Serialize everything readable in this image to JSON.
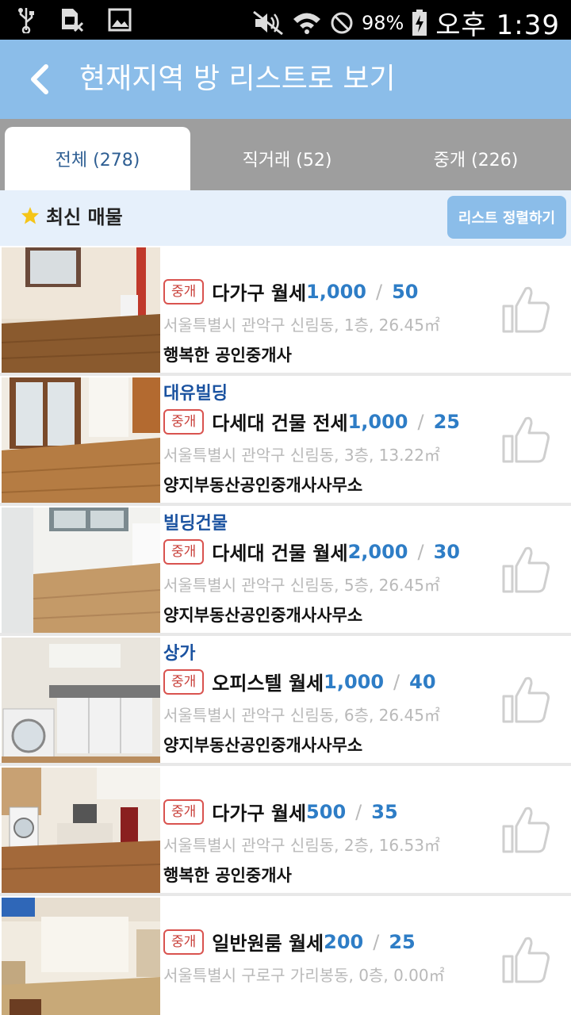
{
  "status_bar": {
    "battery": "98%",
    "time": "오후 1:39"
  },
  "app_bar": {
    "title": "현재지역 방 리스트로 보기"
  },
  "tabs": [
    {
      "label": "전체 (278)",
      "active": true
    },
    {
      "label": "직거래 (52)",
      "active": false
    },
    {
      "label": "중개 (226)",
      "active": false
    }
  ],
  "section": {
    "title": "최신 매물",
    "sort_button": "리스트 정렬하기"
  },
  "listings": [
    {
      "building": "",
      "badge": "중개",
      "type": "다가구 월세",
      "deposit": "1,000",
      "rent": "50",
      "address": "서울특별시 관악구 신림동, 1층, 26.45㎡",
      "agency": "행복한 공인중개사"
    },
    {
      "building": "대유빌딩",
      "badge": "중개",
      "type": "다세대 건물 전세",
      "deposit": "1,000",
      "rent": "25",
      "address": "서울특별시 관악구 신림동, 3층, 13.22㎡",
      "agency": "양지부동산공인중개사사무소"
    },
    {
      "building": "빌딩건물",
      "badge": "중개",
      "type": "다세대 건물 월세",
      "deposit": "2,000",
      "rent": "30",
      "address": "서울특별시 관악구 신림동, 5층, 26.45㎡",
      "agency": "양지부동산공인중개사사무소"
    },
    {
      "building": "상가",
      "badge": "중개",
      "type": "오피스텔 월세",
      "deposit": "1,000",
      "rent": "40",
      "address": "서울특별시 관악구 신림동, 6층, 26.45㎡",
      "agency": "양지부동산공인중개사사무소"
    },
    {
      "building": "",
      "badge": "중개",
      "type": "다가구 월세",
      "deposit": "500",
      "rent": "35",
      "address": "서울특별시 관악구 신림동, 2층, 16.53㎡",
      "agency": "행복한 공인중개사"
    },
    {
      "building": "",
      "badge": "중개",
      "type": "일반원룸 월세",
      "deposit": "200",
      "rent": "25",
      "address": "서울특별시 구로구 가리봉동, 0층, 0.00㎡",
      "agency": ""
    }
  ],
  "colors": {
    "app_bar": "#8bbde9",
    "price": "#2e7dc6",
    "badge": "#d9534f",
    "building": "#1a52a0"
  }
}
